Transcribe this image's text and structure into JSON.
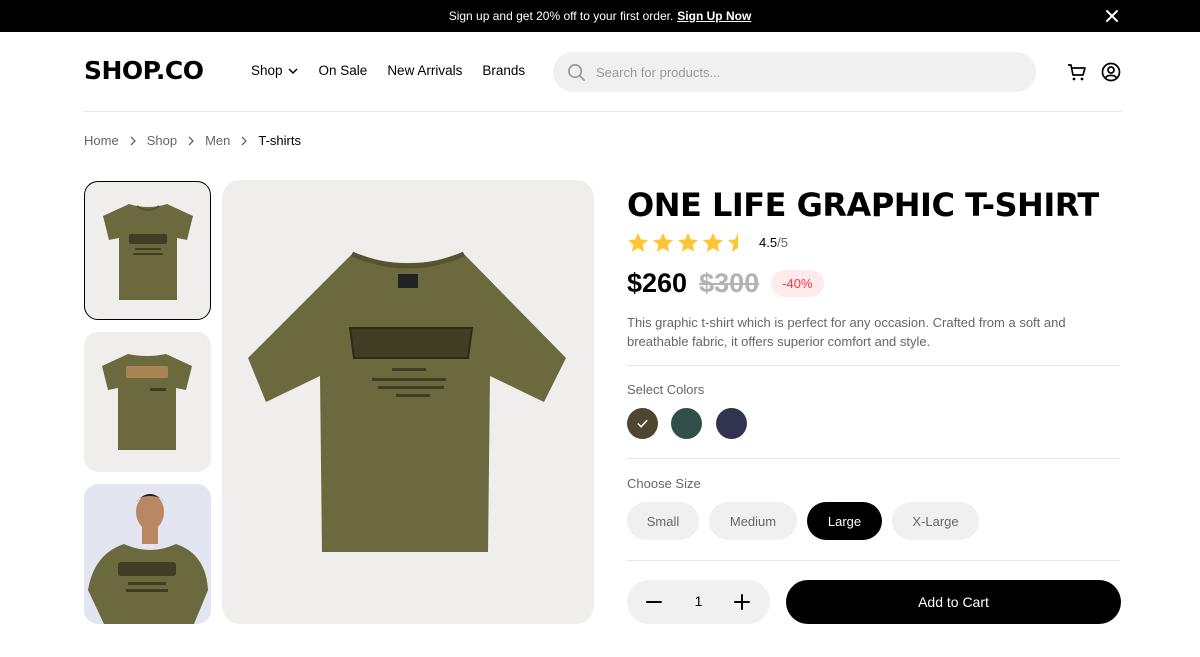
{
  "announcement": {
    "text": "Sign up and get 20% off to your first order.",
    "link": "Sign Up Now"
  },
  "header": {
    "logo": "SHOP.CO",
    "nav": [
      "Shop",
      "On Sale",
      "New Arrivals",
      "Brands"
    ],
    "search_placeholder": "Search for products..."
  },
  "breadcrumb": [
    "Home",
    "Shop",
    "Men",
    "T-shirts"
  ],
  "product": {
    "title": "ONE LIFE GRAPHIC T-SHIRT",
    "rating": "4.5",
    "rating_max": "/5",
    "rating_value": 4.5,
    "price": "$260",
    "old_price": "$300",
    "discount": "-40%",
    "description": "This graphic t-shirt which is perfect for any occasion. Crafted from a soft and breathable fabric, it offers superior comfort and style.",
    "colors_label": "Select Colors",
    "colors": [
      "#4f4631",
      "#314f4a",
      "#31344f"
    ],
    "selected_color": 0,
    "size_label": "Choose Size",
    "sizes": [
      "Small",
      "Medium",
      "Large",
      "X-Large"
    ],
    "selected_size": "Large",
    "quantity": "1",
    "add_to_cart": "Add to Cart"
  },
  "thumbnails": [
    "tshirt-front",
    "tshirt-back",
    "model-wearing-tshirt"
  ],
  "colors": {
    "star": "#ffc633",
    "shirt": "#6b6a3e",
    "discount_bg": "#ffebeb",
    "discount_text": "#ff3333"
  }
}
